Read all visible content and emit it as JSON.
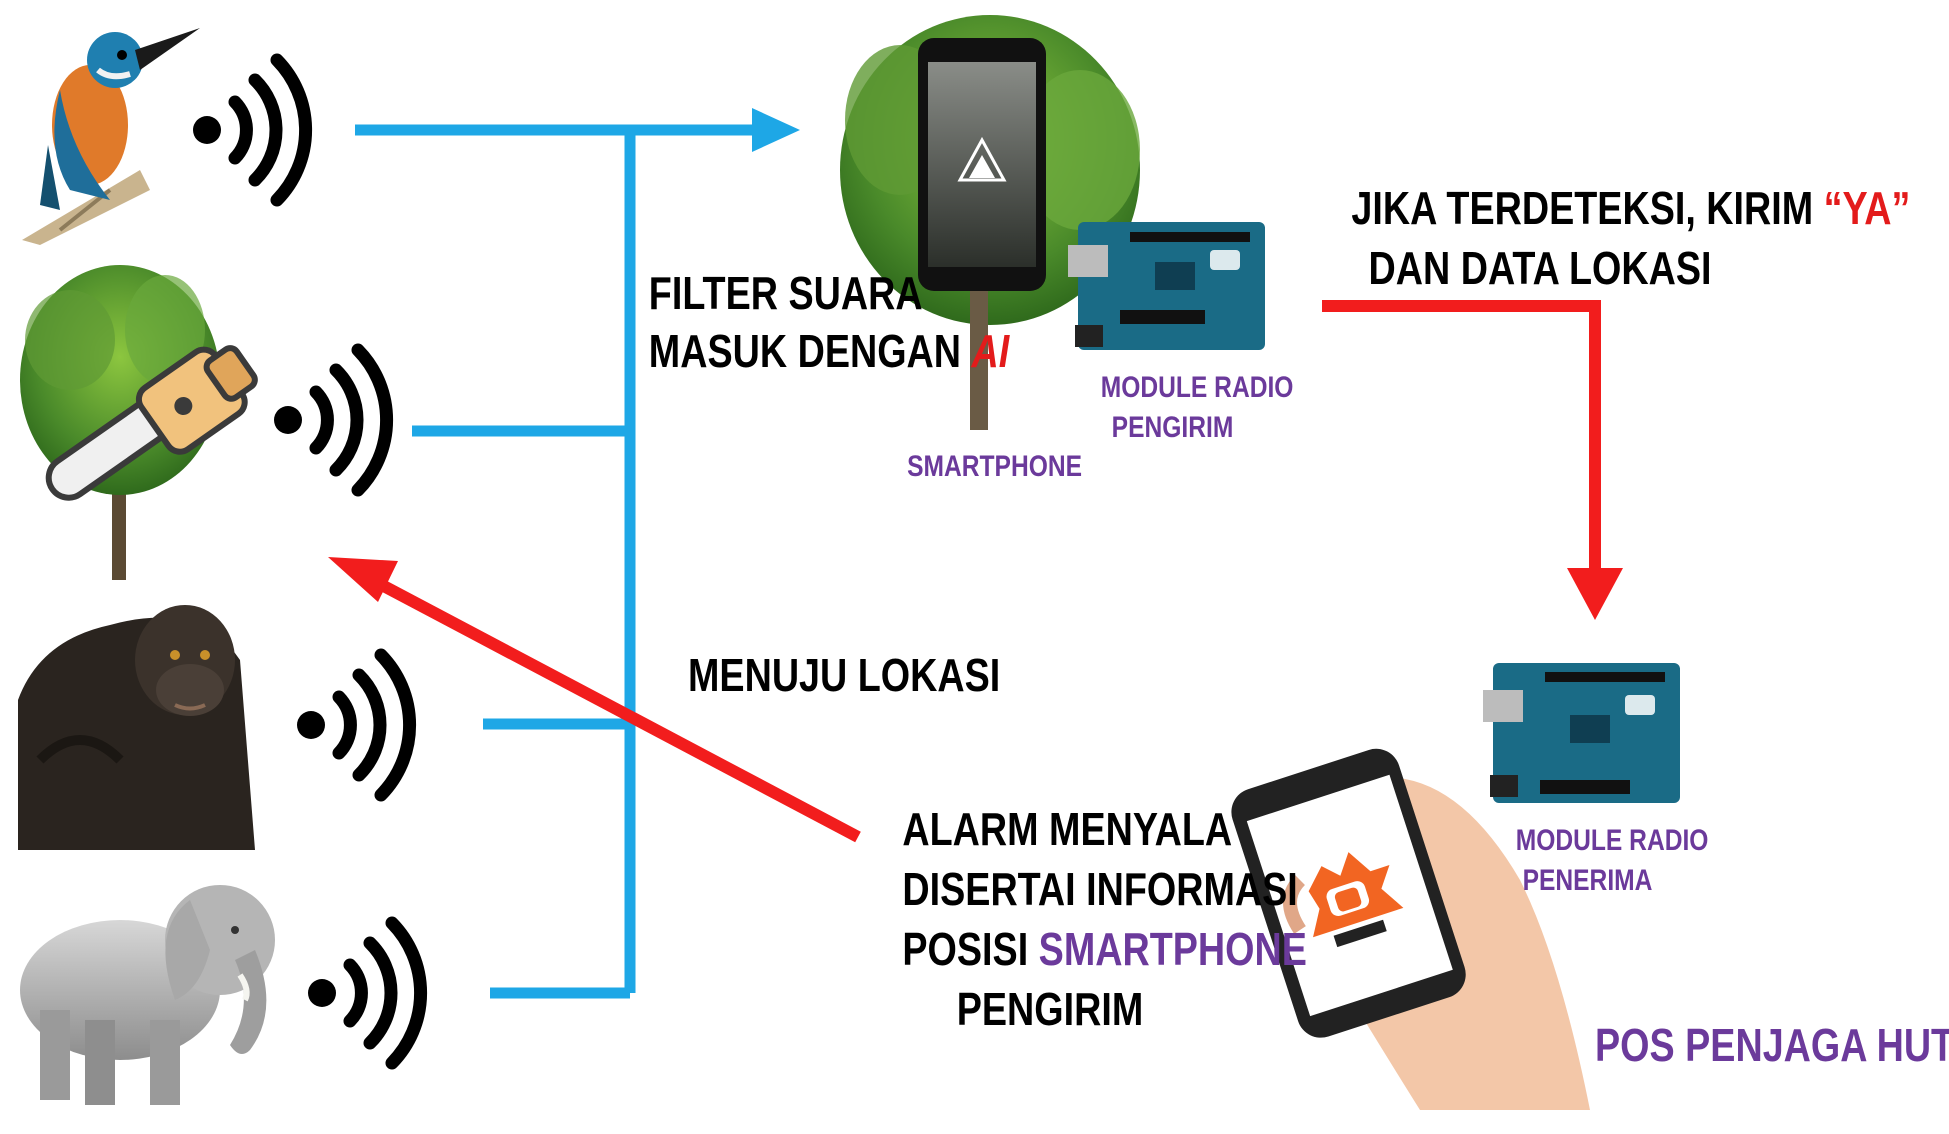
{
  "labels": {
    "filter_line1": "FILTER SUARA",
    "filter_line2_prefix": "MASUK DENGAN ",
    "filter_line2_ai": "AI",
    "smartphone": "SMARTPHONE",
    "module_sender_line1": "MODULE RADIO",
    "module_sender_line2": "PENGIRIM",
    "detect_line1_prefix": "JIKA TERDETEKSI, KIRIM ",
    "detect_line1_highlight": "“YA”",
    "detect_line2": "DAN DATA LOKASI",
    "module_receiver_line1": "MODULE RADIO",
    "module_receiver_line2": "PENERIMA",
    "go_location": "MENUJU LOKASI",
    "alarm_line1": "ALARM MENYALA",
    "alarm_line2": "DISERTAI INFORMASI",
    "alarm_line3_prefix": "POSISI ",
    "alarm_line3_highlight": "SMARTPHONE",
    "alarm_line4": "PENGIRIM",
    "ranger_post": "POS PENJAGA HUTAN"
  },
  "colors": {
    "blue_line": "#1ea7e6",
    "red_arrow": "#f21d1d",
    "purple_text": "#6b3a9b",
    "red_text": "#e31b1b"
  },
  "icons": [
    "kingfisher-bird-icon",
    "tree-chainsaw-icon",
    "gorilla-icon",
    "elephant-icon",
    "sound-wave-icon",
    "smartphone-tree-icon",
    "arduino-board-icon",
    "alarm-phone-hand-icon"
  ]
}
